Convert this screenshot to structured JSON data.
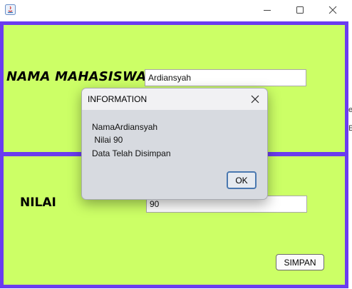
{
  "window": {
    "icon": "java-icon",
    "controls": [
      "minimize-icon",
      "maximize-icon",
      "close-icon"
    ]
  },
  "form": {
    "nama_label": "NAMA MAHASISWA",
    "nama_value": "Ardiansyah",
    "nilai_label": "NILAI",
    "nilai_value": "90",
    "simpan_label": "SIMPAN"
  },
  "colors": {
    "panel_background": "#ccff66",
    "panel_border": "#6a3cf0"
  },
  "dialog": {
    "title": "INFORMATION",
    "lines": [
      "NamaArdiansyah",
      " Nilai 90",
      "Data Telah Disimpan"
    ],
    "ok_label": "OK"
  },
  "edge_fragments": [
    "e",
    "E"
  ]
}
